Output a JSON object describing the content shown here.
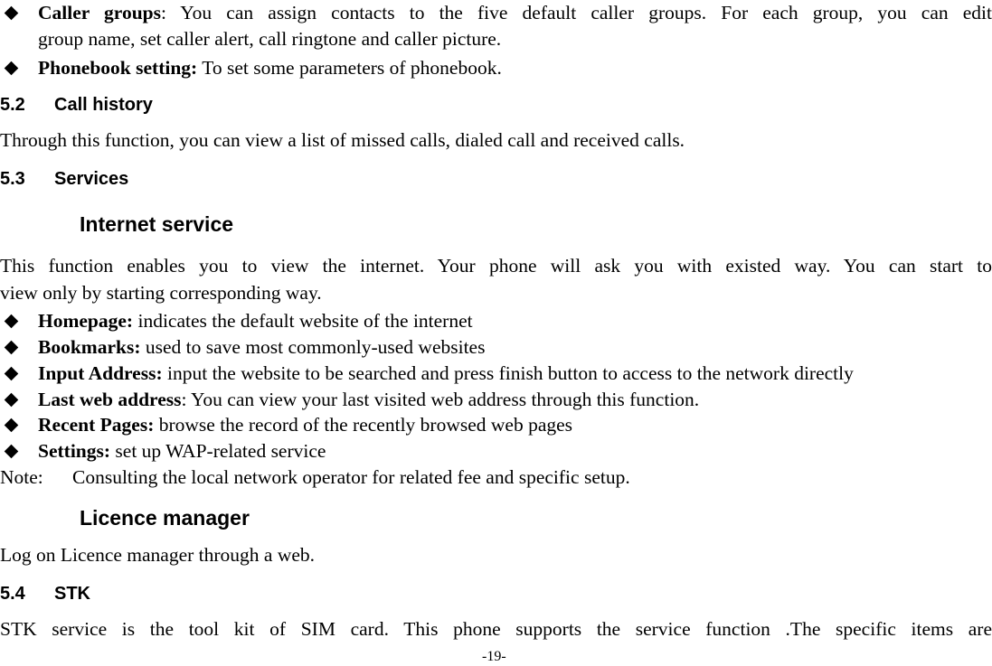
{
  "caller_groups": {
    "term": "Caller groups",
    "line1": ": You can assign contacts to the five default caller groups. For each group, you can edit",
    "line2": "group name, set caller alert, call ringtone and caller picture."
  },
  "phonebook_setting": {
    "term": "Phonebook setting:",
    "text": " To set some parameters of phonebook."
  },
  "section_5_2": {
    "number": "5.2",
    "title": "Call history",
    "body": "Through this function, you can view a list of missed calls, dialed call and received calls."
  },
  "section_5_3": {
    "number": "5.3",
    "title": "Services"
  },
  "internet_service": {
    "title": "Internet service",
    "para_line1": "This function enables you to view the internet. Your phone will ask you with existed way. You can start to",
    "para_line2": "view only by starting corresponding way.",
    "items": [
      {
        "term": "Homepage:",
        "text": " indicates the default website of the internet"
      },
      {
        "term": "Bookmarks:",
        "text": " used to save most commonly-used websites"
      },
      {
        "term": "Input Address:",
        "text": " input the website to be searched and press finish button to access to the network directly"
      },
      {
        "term": "Last web address",
        "text": ": You can view your last visited web address through this function."
      },
      {
        "term": "Recent Pages:",
        "text": " browse the record of the recently browsed web pages"
      },
      {
        "term": "Settings:",
        "text": " set up WAP-related service"
      }
    ],
    "note_label": "Note:",
    "note_text": "Consulting the local network operator for related fee and specific setup."
  },
  "licence_manager": {
    "title": "Licence manager",
    "body": "Log on Licence manager through a web."
  },
  "section_5_4": {
    "number": "5.4",
    "title": "STK",
    "body": "STK service is the tool kit of SIM card. This phone supports the service function .The specific items are"
  },
  "page_number": "-19-"
}
